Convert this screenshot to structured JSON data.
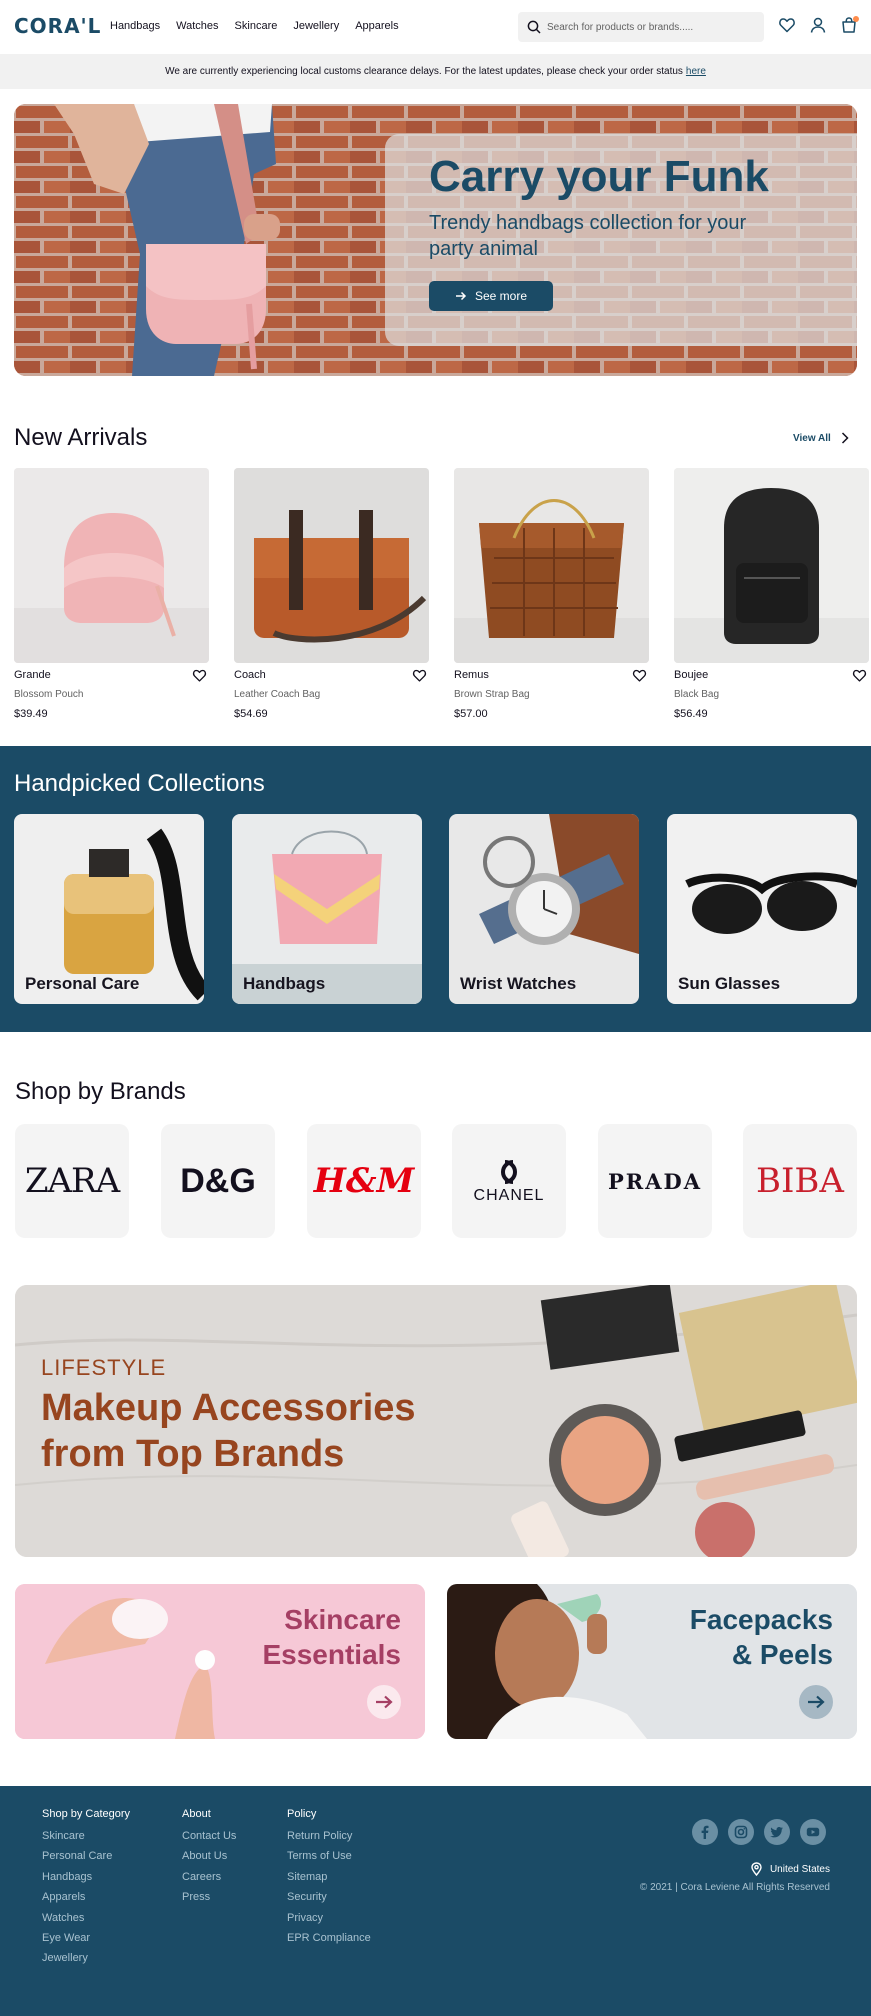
{
  "header": {
    "logo": "CORA'L",
    "nav": [
      "Handbags",
      "Watches",
      "Skincare",
      "Jewellery",
      "Apparels"
    ],
    "search_placeholder": "Search for products or brands....."
  },
  "notice": {
    "text": "We are currently experiencing local customs clearance delays. For the latest updates, please check your order status",
    "link": "here"
  },
  "hero": {
    "title": "Carry your Funk",
    "subtitle": "Trendy handbags collection for your party animal",
    "button": "See more"
  },
  "new_arrivals": {
    "title": "New Arrivals",
    "view_all": "View All",
    "products": [
      {
        "name": "Grande",
        "desc": "Blossom Pouch",
        "price": "$39.49"
      },
      {
        "name": "Coach",
        "desc": "Leather Coach Bag",
        "price": "$54.69"
      },
      {
        "name": "Remus",
        "desc": "Brown Strap Bag",
        "price": "$57.00"
      },
      {
        "name": "Boujee",
        "desc": "Black Bag",
        "price": "$56.49"
      }
    ]
  },
  "collections": {
    "title": "Handpicked Collections",
    "items": [
      "Personal Care",
      "Handbags",
      "Wrist Watches",
      "Sun Glasses"
    ]
  },
  "brands": {
    "title": "Shop by Brands",
    "items": [
      "ZARA",
      "D&G",
      "H&M",
      "CHANEL",
      "PRADA",
      "BIBA"
    ]
  },
  "lifestyle": {
    "kicker": "LIFESTYLE",
    "title_line1": "Makeup Accessories",
    "title_line2": "from Top Brands"
  },
  "promos": [
    {
      "line1": "Skincare",
      "line2": "Essentials"
    },
    {
      "line1": "Facepacks",
      "line2": "& Peels"
    }
  ],
  "footer": {
    "category": {
      "heading": "Shop by Category",
      "items": [
        "Skincare",
        "Personal Care",
        "Handbags",
        "Apparels",
        "Watches",
        "Eye Wear",
        "Jewellery"
      ]
    },
    "about": {
      "heading": "About",
      "items": [
        "Contact Us",
        "About Us",
        "Careers",
        "Press"
      ]
    },
    "policy": {
      "heading": "Policy",
      "items": [
        "Return Policy",
        "Terms of Use",
        "Sitemap",
        "Security",
        "Privacy",
        "EPR Compliance"
      ]
    },
    "country": "United States",
    "copyright": "© 2021 | Cora Leviene All Rights Reserved"
  },
  "colors": {
    "primary": "#1b4b66",
    "accent": "#97451f",
    "skincare": "#a53f64"
  },
  "icons": [
    "search-icon",
    "heart-icon",
    "user-icon",
    "bag-icon",
    "arrow-right-icon",
    "chevron-right-icon",
    "facebook-icon",
    "instagram-icon",
    "twitter-icon",
    "youtube-icon",
    "location-icon"
  ]
}
